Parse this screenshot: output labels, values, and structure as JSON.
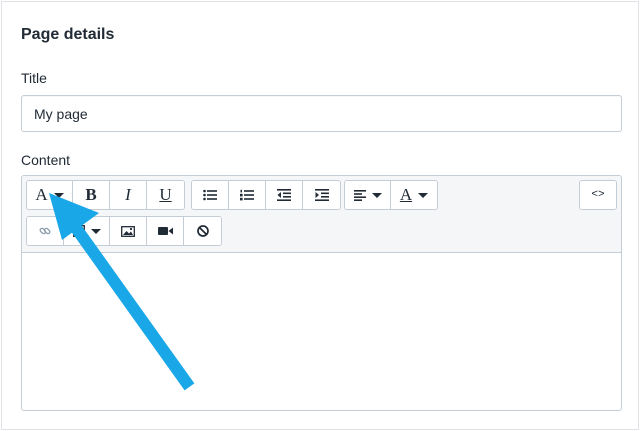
{
  "card": {
    "title": "Page details"
  },
  "title_field": {
    "label": "Title",
    "value": "My page"
  },
  "content_field": {
    "label": "Content"
  },
  "toolbar": {
    "font_format_glyph": "A",
    "bold_glyph": "B",
    "italic_glyph": "I",
    "underline_glyph": "U",
    "text_color_glyph": "A",
    "html_toggle_glyph": "<>"
  },
  "icons": [
    "font-style-icon",
    "bold-icon",
    "italic-icon",
    "underline-icon",
    "bulleted-list-icon",
    "numbered-list-icon",
    "outdent-icon",
    "indent-icon",
    "align-icon",
    "text-color-icon",
    "code-icon",
    "link-icon",
    "table-icon",
    "image-icon",
    "video-icon",
    "clear-format-icon"
  ],
  "annotation": {
    "arrow_color": "#1aa7e8"
  },
  "colors": {
    "border": "#c4cdd5",
    "toolbar_bg": "#f4f6f8",
    "text": "#212b36"
  }
}
